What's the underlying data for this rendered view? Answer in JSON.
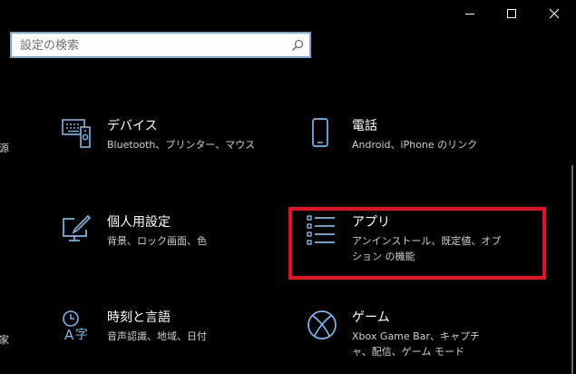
{
  "window": {
    "minimize_icon": "minimize-icon",
    "maximize_icon": "maximize-icon",
    "close_icon": "close-icon"
  },
  "search": {
    "placeholder": "設定の検索",
    "icon": "search-icon"
  },
  "edge_fragments": [
    "源",
    "家"
  ],
  "tiles": [
    {
      "title": "デバイス",
      "desc": "Bluetooth、プリンター、マウス",
      "icon": "devices-icon"
    },
    {
      "title": "電話",
      "desc": "Android、iPhone のリンク",
      "icon": "phone-icon"
    },
    {
      "title": "個人用設定",
      "desc": "背景、ロック画面、色",
      "icon": "personalization-icon"
    },
    {
      "title": "アプリ",
      "desc": "アンインストール、既定値、オプション の機能",
      "icon": "apps-icon"
    },
    {
      "title": "時刻と言語",
      "desc": "音声認識、地域、日付",
      "icon": "time-language-icon"
    },
    {
      "title": "ゲーム",
      "desc": "Xbox Game Bar、キャプチャ、配信、ゲーム モード",
      "icon": "xbox-icon"
    }
  ],
  "colors": {
    "accent": "#76b9ed",
    "highlight": "#e81123",
    "background": "#000000"
  }
}
